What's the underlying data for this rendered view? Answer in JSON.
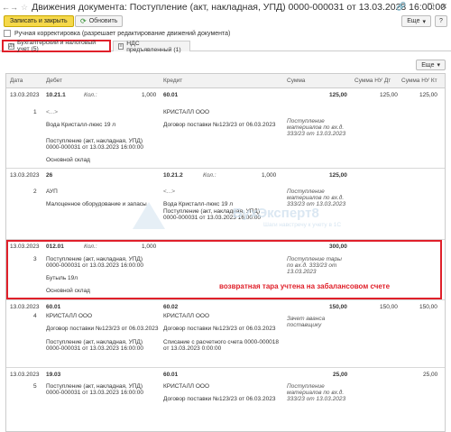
{
  "window": {
    "title": "Движения документа: Поступление (акт, накладная, УПД) 0000-000031 от 13.03.2023 16:00:00"
  },
  "toolbar": {
    "save_close_label": "Записать и закрыть",
    "refresh_label": "Обновить",
    "more_label": "Еще",
    "help_label": "?"
  },
  "manual_correction_label": "Ручная корректировка (разрешает редактирование движений документа)",
  "tabs": [
    {
      "label": "Бухгалтерский и налоговый учет (5)"
    },
    {
      "label": "НДС предъявленный (1)"
    }
  ],
  "table_more_label": "Еще",
  "columns": {
    "date": "Дата",
    "debit": "Дебет",
    "credit": "Кредит",
    "sum": "Сумма",
    "sum_nu_dt": "Сумма НУ Дт",
    "sum_nu_kt": "Сумма НУ Кт"
  },
  "rows": [
    {
      "date": "13.03.2023",
      "num": "1",
      "debit_account": "10.21.1",
      "debit_qty_label": "Кол.:",
      "debit_qty": "1,000",
      "debit_sub1": "<...>",
      "debit_sub2": "Вода Кристалл-люкс 19 л",
      "debit_sub3": "Поступление (акт, накладная, УПД)",
      "debit_sub4": "0000-000031 от 13.03.2023 16:00:00",
      "debit_sub5": "Основной склад",
      "credit_account": "60.01",
      "credit_sub1": "КРИСТАЛЛ ООО",
      "credit_sub2": "Договор поставки №123/23 от 06.03.2023",
      "sum": "125,00",
      "sum_nu_dt": "125,00",
      "sum_nu_kt": "125,00",
      "content1": "Поступление",
      "content2": "материалов по вх.д.",
      "content3": "333/23 от 13.03.2023"
    },
    {
      "date": "13.03.2023",
      "num": "2",
      "debit_account": "26",
      "debit_sub1": "АУП",
      "debit_sub2": "Малоценное оборудование и запасы",
      "credit_account": "10.21.2",
      "credit_qty_label": "Кол.:",
      "credit_qty": "1,000",
      "credit_sub1": "<...>",
      "credit_sub2": "Вода Кристалл-люкс 19 л",
      "credit_sub3": "Поступление (акт, накладная, УПД)",
      "credit_sub4": "0000-000031 от 13.03.2023 16:00:00",
      "sum": "125,00",
      "content1": "Поступление",
      "content2": "материалов по вх.д.",
      "content3": "333/23 от 13.03.2023"
    },
    {
      "date": "13.03.2023",
      "num": "3",
      "debit_account": "012.01",
      "debit_qty_label": "Кол.:",
      "debit_qty": "1,000",
      "debit_sub1": "Поступление (акт, накладная, УПД)",
      "debit_sub2": "0000-000031 от 13.03.2023 16:00:00",
      "debit_sub3": "Бутыль 19л",
      "debit_sub4": "Основной склад",
      "sum": "300,00",
      "content1": "Поступление тары",
      "content2": "по вх.д. 333/23 от",
      "content3": "13.03.2023"
    },
    {
      "date": "13.03.2023",
      "num": "4",
      "debit_account": "60.01",
      "debit_sub1": "КРИСТАЛЛ ООО",
      "debit_sub2": "Договор поставки №123/23 от 06.03.2023",
      "debit_sub3": "Поступление (акт, накладная, УПД)",
      "debit_sub4": "0000-000031 от 13.03.2023 16:00:00",
      "credit_account": "60.02",
      "credit_sub1": "КРИСТАЛЛ ООО",
      "credit_sub2": "Договор поставки №123/23 от 06.03.2023",
      "credit_sub3": "Списание с расчетного счета 0000-000018",
      "credit_sub4": "от 13.03.2023 0:00:00",
      "sum": "150,00",
      "sum_nu_dt": "150,00",
      "sum_nu_kt": "150,00",
      "content1": "Зачет аванса",
      "content2": "поставщику"
    },
    {
      "date": "13.03.2023",
      "num": "5",
      "debit_account": "19.03",
      "debit_sub1": "Поступление (акт, накладная, УПД)",
      "debit_sub2": "0000-000031 от 13.03.2023 16:00:00",
      "credit_account": "60.01",
      "credit_sub1": "КРИСТАЛЛ ООО",
      "credit_sub2": "Договор поставки №123/23 от 06.03.2023",
      "sum": "25,00",
      "sum_nu_kt": "25,00",
      "content1": "Поступление",
      "content2": "материалов по вх.д.",
      "content3": "333/23 от 13.03.2023"
    }
  ],
  "annotation": "возвратная тара учтена на забалансовом счете",
  "watermark": {
    "main": "БухЭксперт8",
    "sub": "Шаги навстречу к учету в 1С"
  },
  "colors": {
    "highlight": "#e0202a",
    "primary_button": "#f5d84a"
  }
}
